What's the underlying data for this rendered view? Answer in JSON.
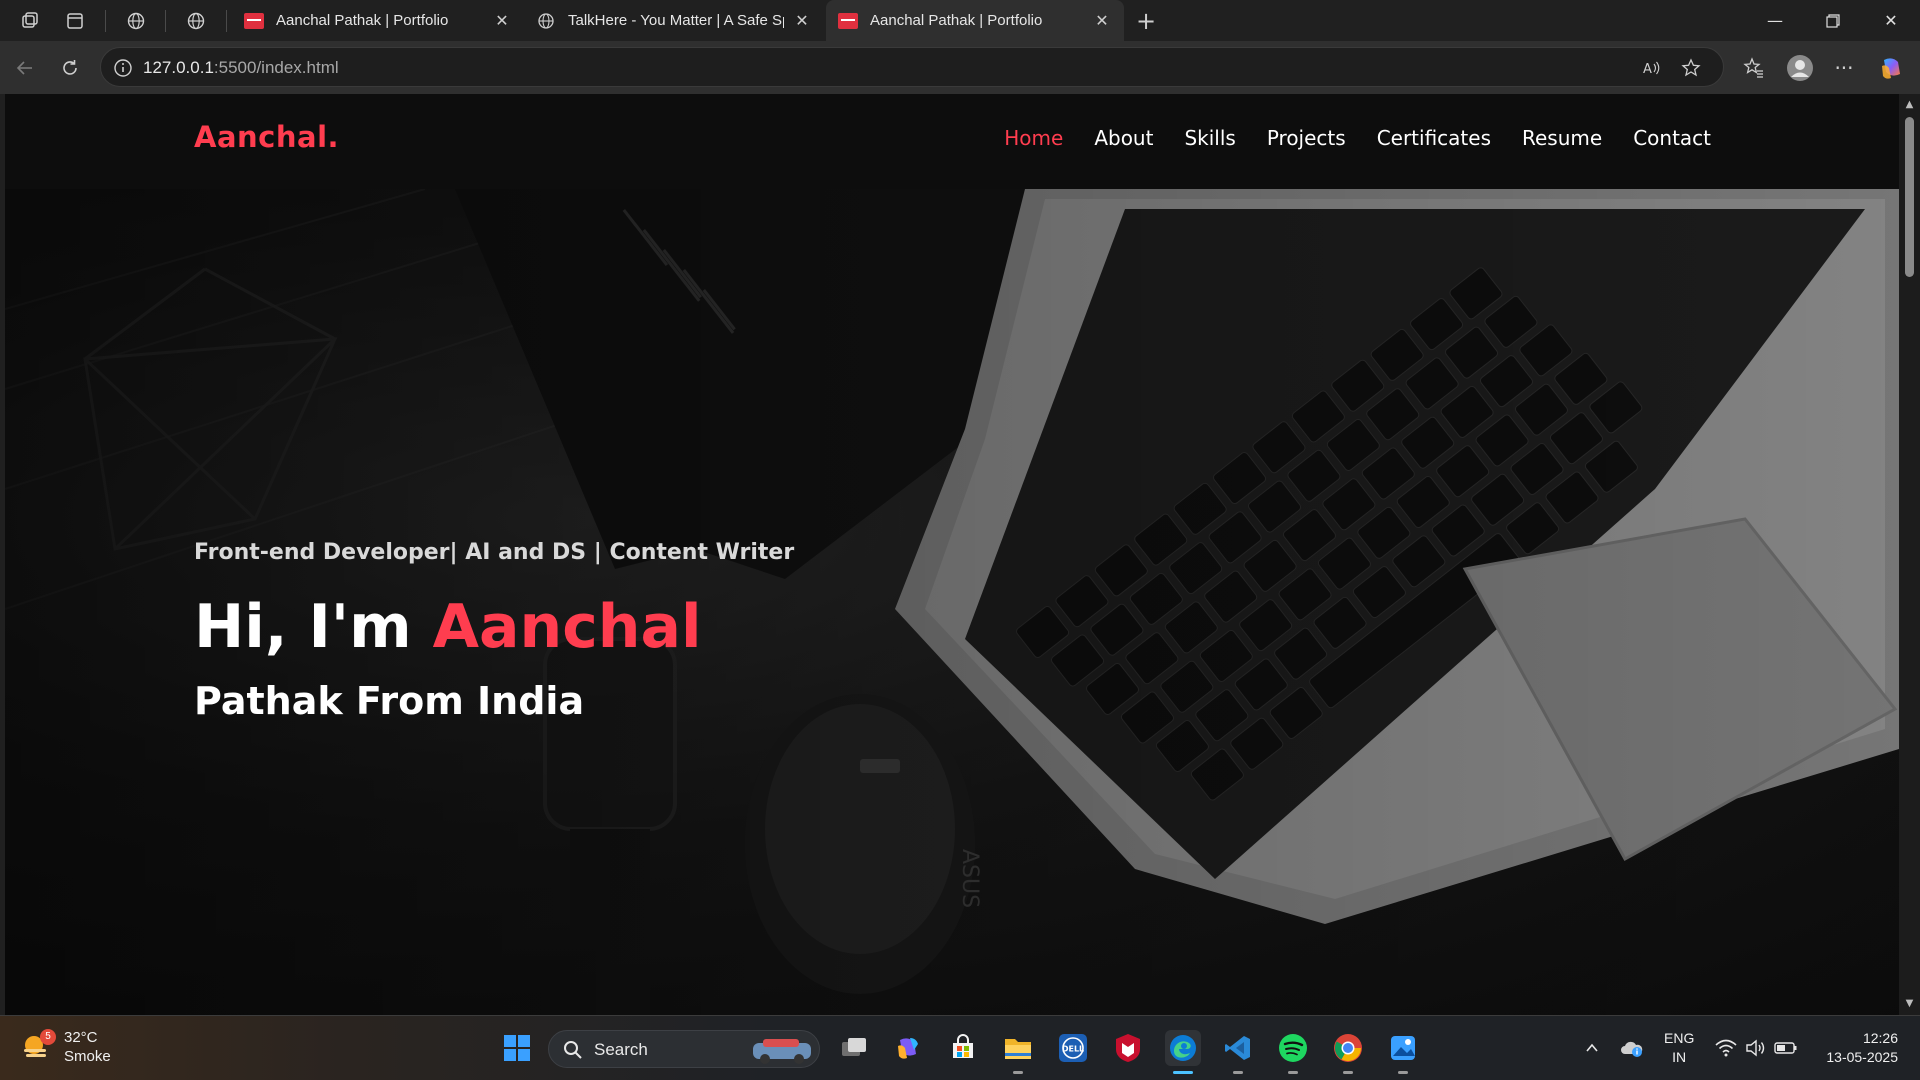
{
  "browser": {
    "tabs": [
      {
        "title": "Aanchal Pathak | Portfolio",
        "active": false
      },
      {
        "title": "TalkHere - You Matter | A Safe Space",
        "active": false
      },
      {
        "title": "Aanchal Pathak | Portfolio",
        "active": true
      }
    ],
    "url_host": "127.0.0.1",
    "url_path": ":5500/index.html"
  },
  "site": {
    "logo": "Aanchal.",
    "nav": [
      {
        "label": "Home",
        "active": true
      },
      {
        "label": "About",
        "active": false
      },
      {
        "label": "Skills",
        "active": false
      },
      {
        "label": "Projects",
        "active": false
      },
      {
        "label": "Certificates",
        "active": false
      },
      {
        "label": "Resume",
        "active": false
      },
      {
        "label": "Contact",
        "active": false
      }
    ],
    "hero": {
      "tagline": "Front-end Developer| AI and DS | Content Writer",
      "greeting": "Hi, I'm ",
      "name": "Aanchal",
      "subline": "Pathak From India"
    }
  },
  "taskbar": {
    "weather": {
      "badge": "5",
      "temp": "32°C",
      "condition": "Smoke"
    },
    "search_label": "Search",
    "language": {
      "line1": "ENG",
      "line2": "IN"
    },
    "clock": {
      "time": "12:26",
      "date": "13-05-2025"
    }
  },
  "colors": {
    "accent": "#ff3d4f",
    "header_bg": "#0d0d0d",
    "taskbar_active": "#4cc2ff"
  }
}
